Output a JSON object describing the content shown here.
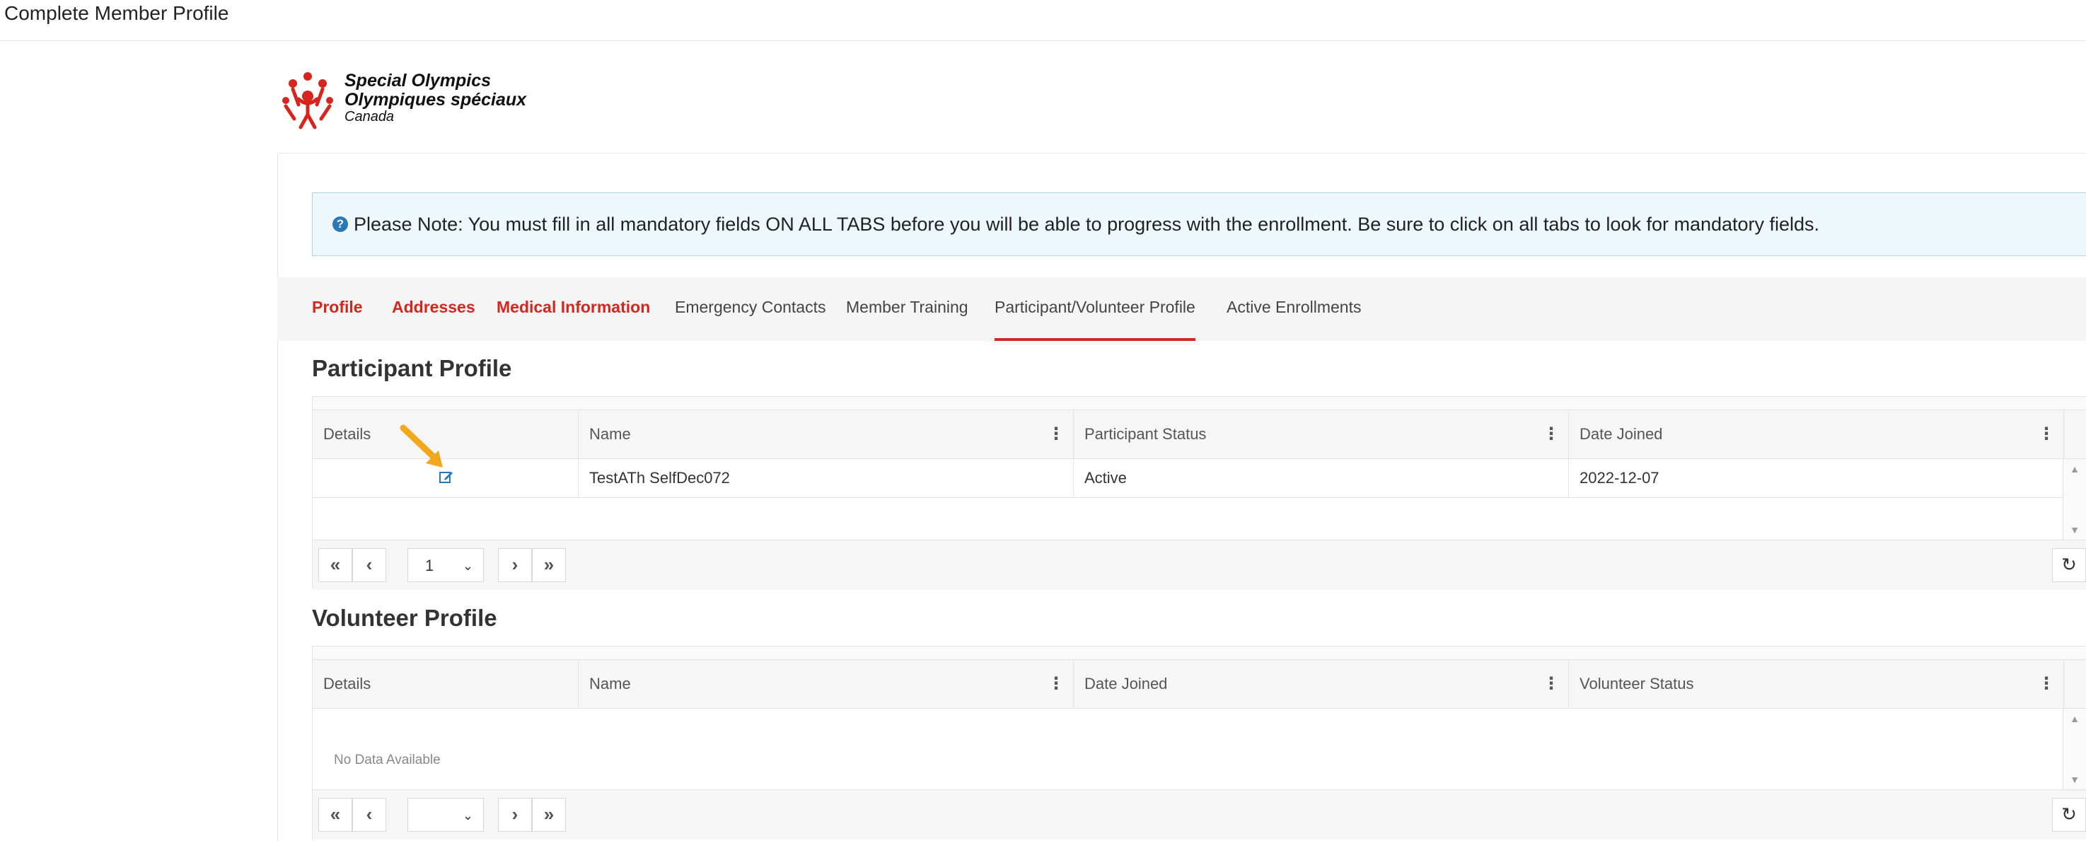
{
  "window": {
    "title": "Complete Member Profile"
  },
  "logo": {
    "line1": "Special Olympics",
    "line2": "Olympiques spéciaux",
    "line3": "Canada"
  },
  "note": {
    "icon": "question-circle-icon",
    "text": "Please Note: You must fill in all mandatory fields ON ALL TABS before you will be able to progress with the enrollment. Be sure to click on all tabs to look for mandatory fields."
  },
  "tabs": [
    {
      "label": "Profile",
      "mandatory": true
    },
    {
      "label": "Addresses",
      "mandatory": true
    },
    {
      "label": "Medical Information",
      "mandatory": true
    },
    {
      "label": "Emergency Contacts",
      "mandatory": false
    },
    {
      "label": "Member Training",
      "mandatory": false
    },
    {
      "label": "Participant/Volunteer Profile",
      "mandatory": false,
      "active": true
    },
    {
      "label": "Active Enrollments",
      "mandatory": false
    }
  ],
  "participant": {
    "title": "Participant Profile",
    "columns": [
      "Details",
      "Name",
      "Participant Status",
      "Date Joined"
    ],
    "rows": [
      {
        "name": "TestATh SelfDec072",
        "status": "Active",
        "date_joined": "2022-12-07"
      }
    ],
    "pager": {
      "page": "1"
    }
  },
  "volunteer": {
    "title": "Volunteer Profile",
    "columns": [
      "Details",
      "Name",
      "Date Joined",
      "Volunteer Status"
    ],
    "empty_text": "No Data Available",
    "pager": {
      "page": ""
    }
  },
  "colors": {
    "accent": "#d6251c",
    "note_bg": "#eef7fb",
    "arrow": "#f2a81d"
  }
}
